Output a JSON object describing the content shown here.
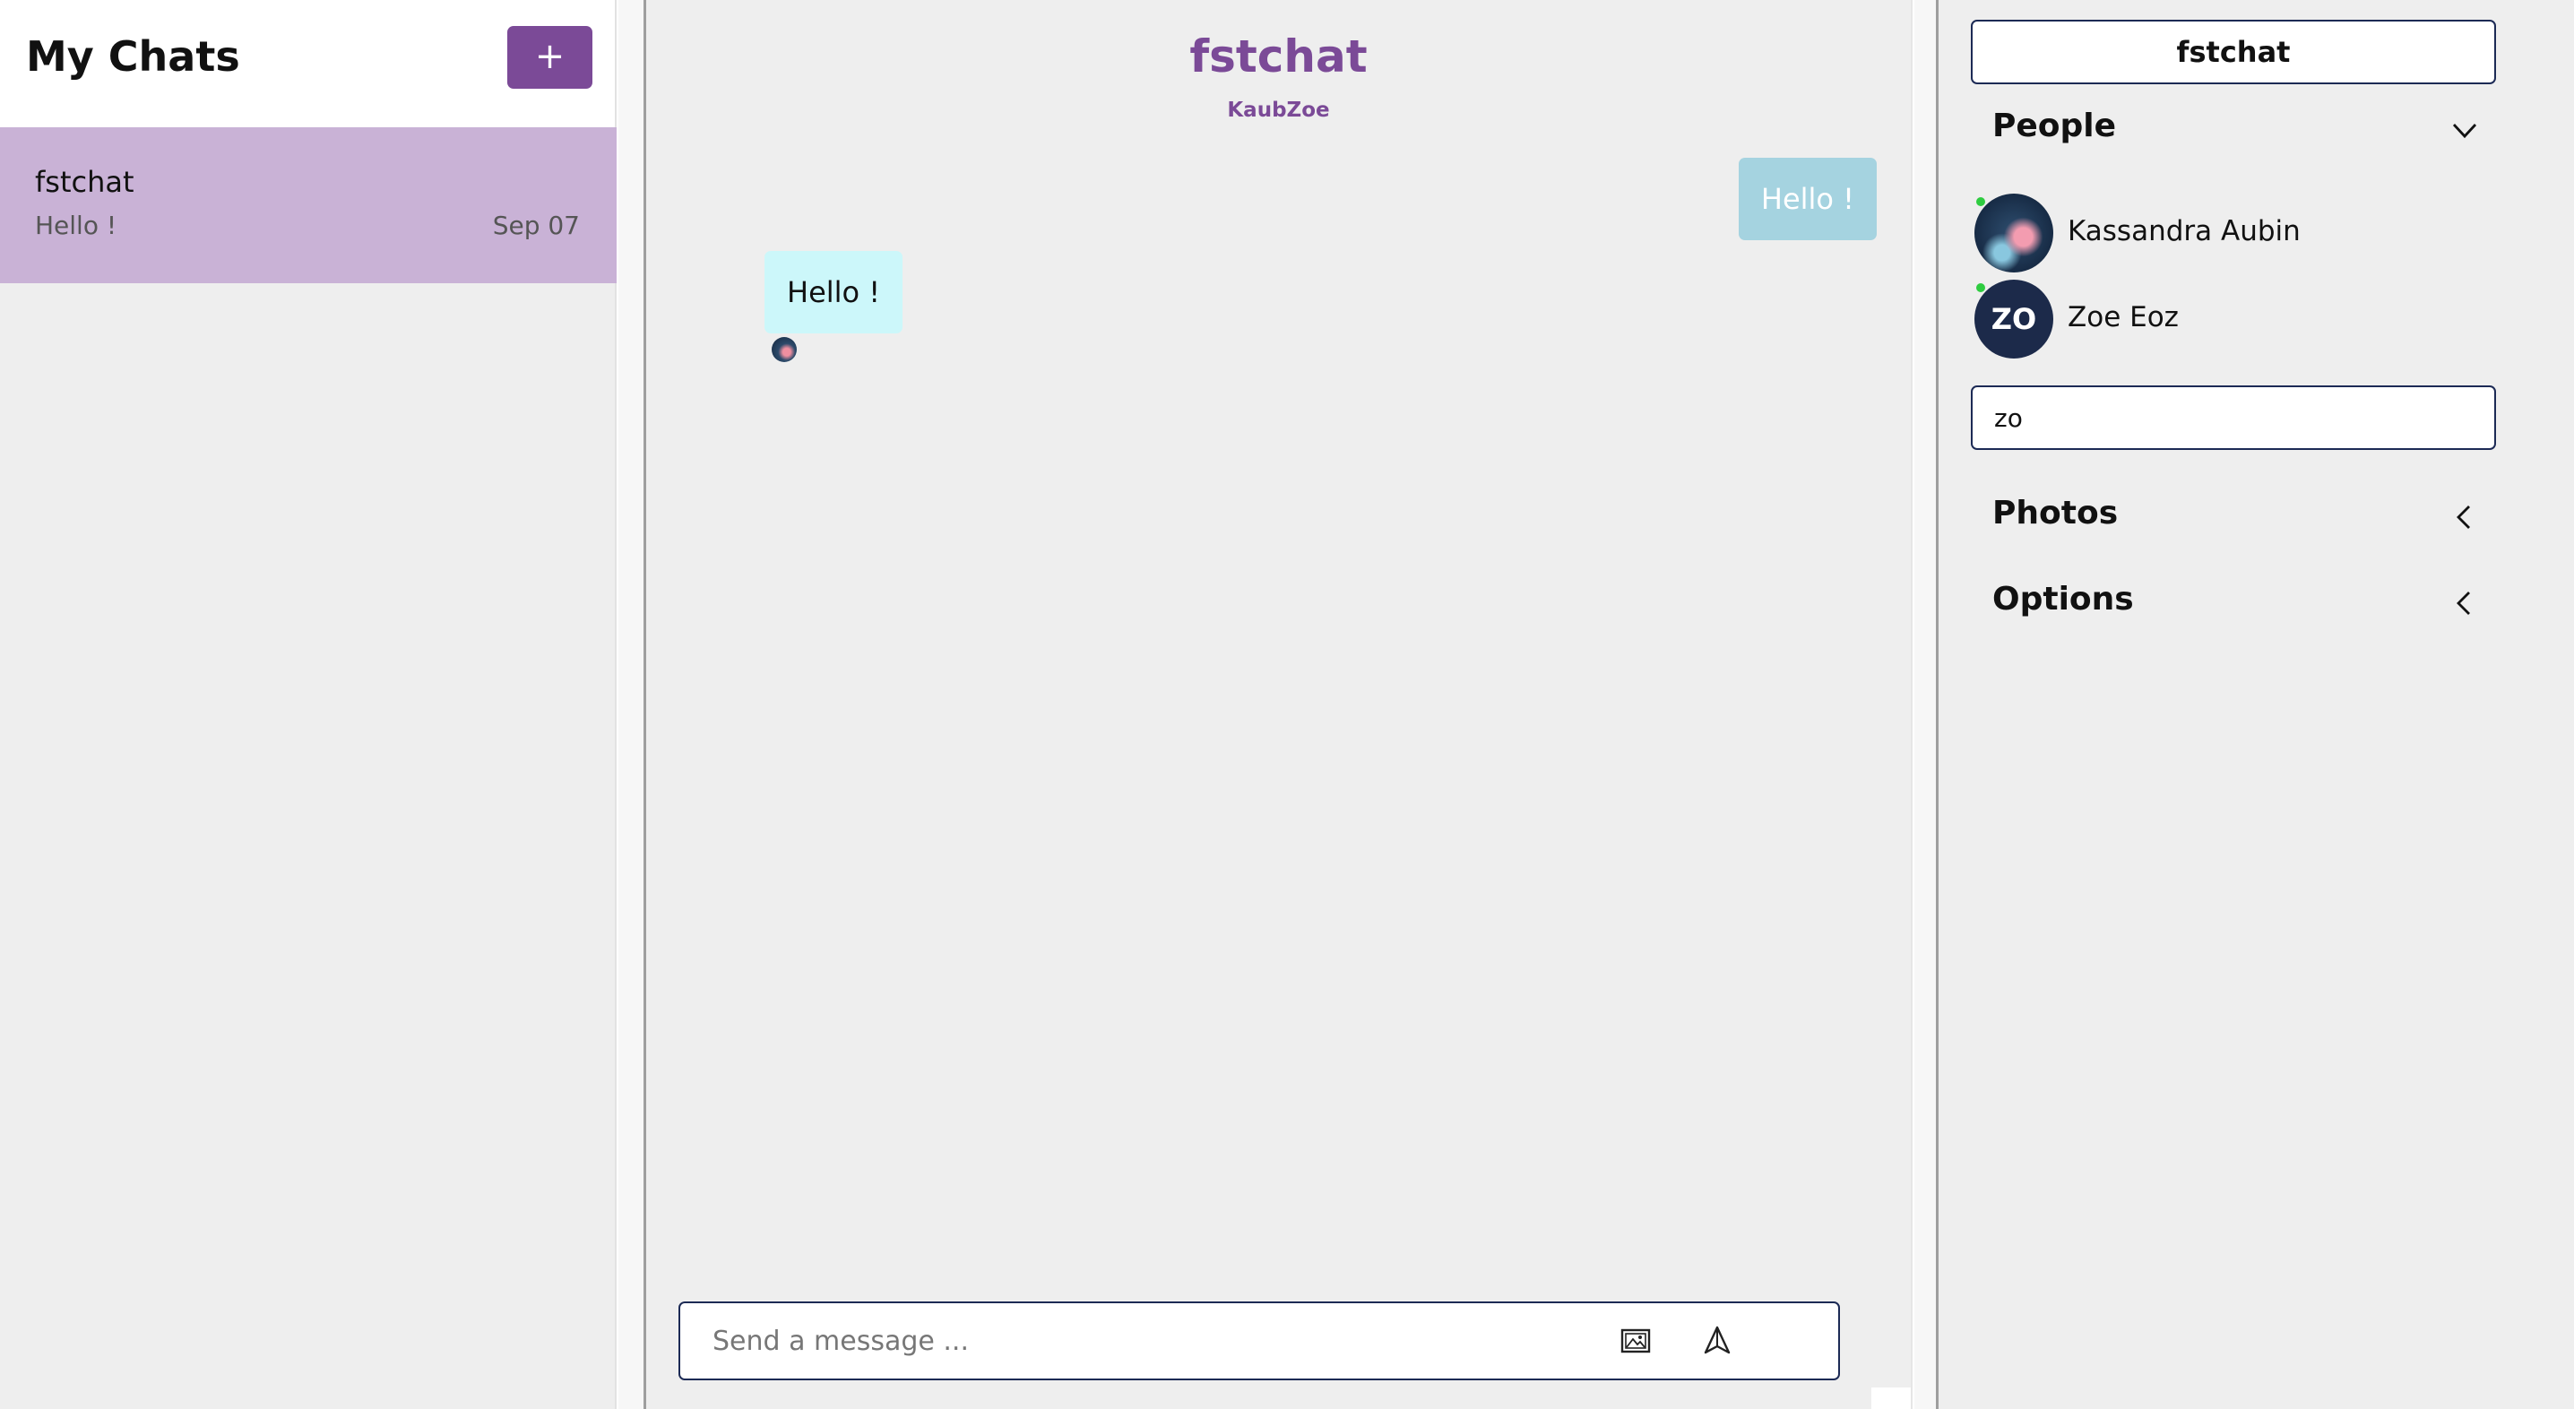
{
  "sidebar": {
    "title": "My Chats",
    "new_chat_label": "+",
    "chats": [
      {
        "title": "fstchat",
        "last_message": "Hello !",
        "date": "Sep 07"
      }
    ]
  },
  "feed": {
    "title": "fstchat",
    "subtitle": "KaubZoe",
    "messages": [
      {
        "text": "Hello !",
        "mine": true
      },
      {
        "text": "Hello !",
        "mine": false
      }
    ],
    "input_placeholder": "Send a message ..."
  },
  "settings": {
    "chat_title_value": "fstchat",
    "people_title": "People",
    "people": [
      {
        "name": "Kassandra Aubin",
        "initials": "",
        "online": true
      },
      {
        "name": "Zoe Eoz",
        "initials": "ZO",
        "online": true
      }
    ],
    "people_search_value": "zo",
    "photos_title": "Photos",
    "options_title": "Options"
  },
  "colors": {
    "accent": "#7b4a97",
    "active_chat": "#c9b2d6",
    "my_bubble": "#a5d3e0",
    "their_bubble": "#ccf7fa",
    "border_dark": "#1c2a55",
    "online": "#2ecc40"
  },
  "icons": {
    "image": "image-icon",
    "send": "send-icon",
    "people_chevron": "chevron-down-icon",
    "photos_chevron": "chevron-left-icon",
    "options_chevron": "chevron-left-icon"
  }
}
